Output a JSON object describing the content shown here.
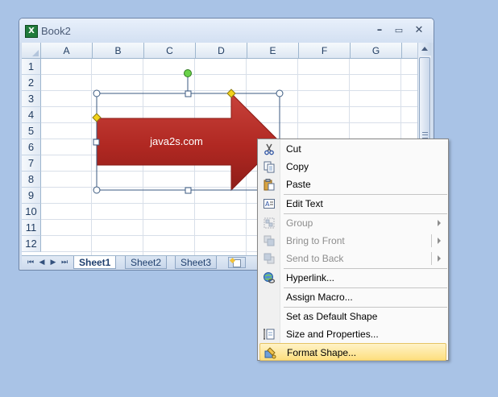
{
  "window": {
    "title": "Book2",
    "icon_letter": "X",
    "icons": {
      "app": "excel-icon",
      "minimize": "minimize-icon",
      "maximize": "maximize-icon",
      "close": "close-icon"
    }
  },
  "grid": {
    "columns": [
      "A",
      "B",
      "C",
      "D",
      "E",
      "F",
      "G"
    ],
    "rows": [
      "1",
      "2",
      "3",
      "4",
      "5",
      "6",
      "7",
      "8",
      "9",
      "10",
      "11",
      "12"
    ]
  },
  "sheet_tabs": {
    "nav_icons": [
      "first-sheet-icon",
      "prev-sheet-icon",
      "next-sheet-icon",
      "last-sheet-icon"
    ],
    "tabs": [
      {
        "label": "Sheet1",
        "active": true
      },
      {
        "label": "Sheet2",
        "active": false
      },
      {
        "label": "Sheet3",
        "active": false
      }
    ],
    "insert_icon": "insert-worksheet-icon"
  },
  "shape": {
    "text": "java2s.com",
    "type": "right-arrow",
    "fill_color": "#b52a24",
    "selected": true
  },
  "context_menu": {
    "items": [
      {
        "label": "Cut",
        "icon": "scissors-icon",
        "enabled": true
      },
      {
        "label": "Copy",
        "icon": "copy-icon",
        "enabled": true
      },
      {
        "label": "Paste",
        "icon": "paste-icon",
        "enabled": true
      },
      {
        "label": "Edit Text",
        "icon": "edit-text-icon",
        "enabled": true
      },
      {
        "label": "Group",
        "icon": "group-icon",
        "enabled": false,
        "submenu": true
      },
      {
        "label": "Bring to Front",
        "icon": "bring-to-front-icon",
        "enabled": false,
        "submenu": true
      },
      {
        "label": "Send to Back",
        "icon": "send-to-back-icon",
        "enabled": false,
        "submenu": true
      },
      {
        "label": "Hyperlink...",
        "icon": "hyperlink-icon",
        "enabled": true
      },
      {
        "label": "Assign Macro...",
        "enabled": true
      },
      {
        "label": "Set as Default Shape",
        "enabled": true
      },
      {
        "label": "Size and Properties...",
        "icon": "size-properties-icon",
        "enabled": true
      },
      {
        "label": "Format Shape...",
        "icon": "format-shape-icon",
        "enabled": true,
        "highlighted": true
      }
    ]
  }
}
